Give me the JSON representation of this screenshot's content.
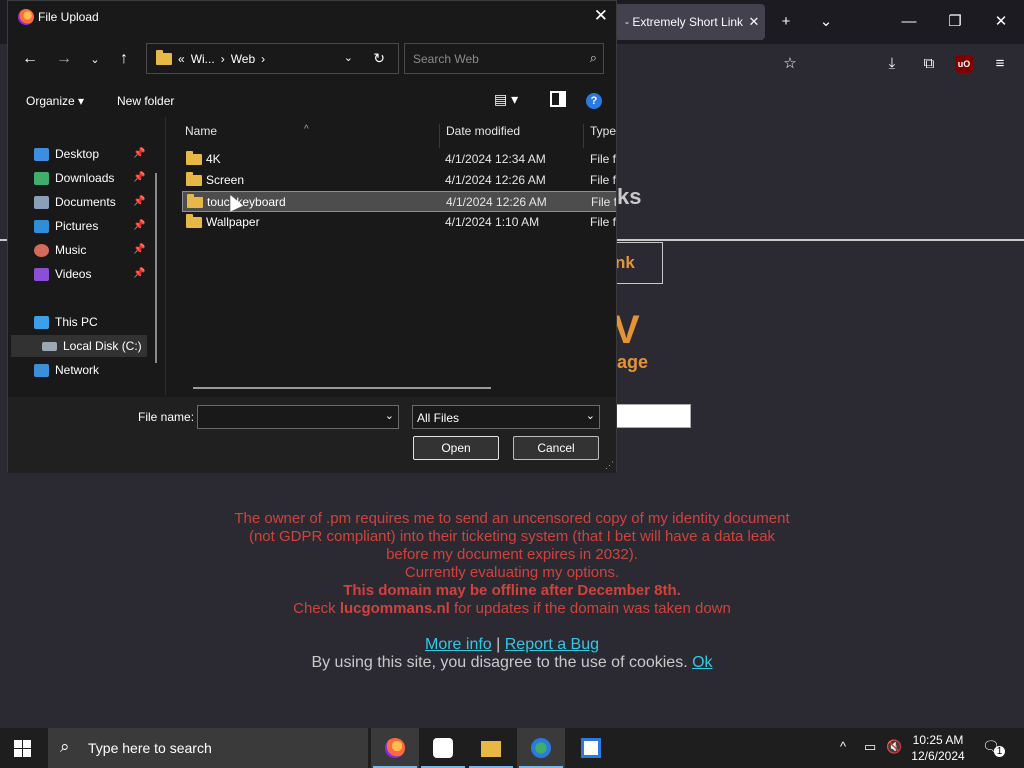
{
  "browser": {
    "tab_title": "- Extremely Short Links",
    "tab_close": "✕",
    "new_tab": "+",
    "tab_list": "⌄",
    "window_controls": {
      "minimize": "—",
      "restore": "❐",
      "close": "✕"
    },
    "toolbar_icons": [
      "bookmark-star-icon",
      "download-icon",
      "extensions-icon",
      "ublock-icon",
      "menu-icon"
    ],
    "ublock_label": "uO"
  },
  "page": {
    "header_fragment": "ks",
    "link_button_fragment": "nk",
    "big_letter": "V",
    "subtitle_fragment": "age",
    "notice_lines": [
      "The owner of .pm requires me to send an uncensored copy of my identity document",
      "(not GDPR compliant) into their ticketing system (that I bet will have a data leak",
      "before my document expires in 2032).",
      "Currently evaluating my options."
    ],
    "offline_notice": "This domain may be offline after December 8th.",
    "check_prefix": "Check ",
    "check_domain": "lucgommans.nl",
    "check_suffix": " for updates if the domain was taken down",
    "more_info": "More info",
    "link_separator": " | ",
    "report_bug": "Report a Bug",
    "cookie_text": "By using this site, you disagree to the use of cookies. ",
    "cookie_ok": "Ok"
  },
  "dialog": {
    "title": "File Upload",
    "close": "✕",
    "address": {
      "overflow": "«",
      "segments": [
        "Wi...",
        "Web"
      ],
      "sep": "›"
    },
    "search_placeholder": "Search Web",
    "organize_label": "Organize ▾",
    "new_folder_label": "New folder",
    "help": "?",
    "nav_items": [
      {
        "label": "Desktop",
        "icon": "desktop-icon",
        "color": "#3c8fe0",
        "pinned": true
      },
      {
        "label": "Downloads",
        "icon": "downloads-icon",
        "color": "#3fae6a",
        "pinned": true
      },
      {
        "label": "Documents",
        "icon": "documents-icon",
        "color": "#8aa0b8",
        "pinned": true
      },
      {
        "label": "Pictures",
        "icon": "pictures-icon",
        "color": "#2e8fd8",
        "pinned": true
      },
      {
        "label": "Music",
        "icon": "music-icon",
        "color": "#d56a5a",
        "pinned": true
      },
      {
        "label": "Videos",
        "icon": "videos-icon",
        "color": "#8a4fd6",
        "pinned": true
      },
      {
        "label": "This PC",
        "icon": "this-pc-icon",
        "color": "#3aa0e8",
        "pinned": false
      },
      {
        "label": "Local Disk (C:)",
        "icon": "local-disk-icon",
        "color": "#9aa8b4",
        "pinned": false
      },
      {
        "label": "Network",
        "icon": "network-icon",
        "color": "#3a8fd8",
        "pinned": false
      }
    ],
    "columns": [
      "Name",
      "Date modified",
      "Type"
    ],
    "files": [
      {
        "name": "4K",
        "date": "4/1/2024 12:34 AM",
        "type": "File fo"
      },
      {
        "name": "Screen",
        "date": "4/1/2024 12:26 AM",
        "type": "File fo"
      },
      {
        "name": "touchkeyboard",
        "date": "4/1/2024 12:26 AM",
        "type": "File fo",
        "selected": true
      },
      {
        "name": "Wallpaper",
        "date": "4/1/2024 1:10 AM",
        "type": "File fo"
      }
    ],
    "file_name_label": "File name:",
    "file_name_value": "",
    "file_type": "All Files",
    "open_label": "Open",
    "cancel_label": "Cancel"
  },
  "taskbar": {
    "search_placeholder": "Type here to search",
    "apps": [
      "firefox",
      "capcut",
      "file-explorer",
      "network-tool",
      "app-window"
    ],
    "time": "10:25 AM",
    "date": "12/6/2024",
    "notification_count": "1"
  }
}
